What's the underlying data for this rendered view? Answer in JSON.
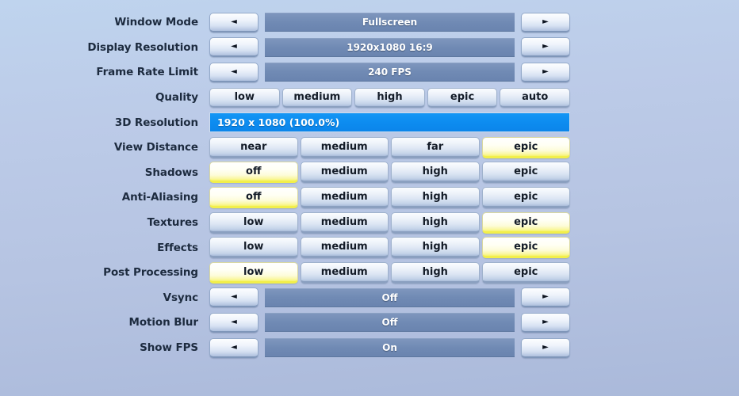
{
  "screen": {
    "name": "video-settings",
    "background_top": "#bfd4ee",
    "background_bottom": "#aab9da"
  },
  "icons": {
    "left_arrow": "◄",
    "right_arrow": "►"
  },
  "colors": {
    "selected_highlight": "#f6f36c",
    "slider_fill": "#0d8cf0",
    "value_bar": "#708ab4",
    "label_text": "#1d2b3f"
  },
  "rows": [
    {
      "label": "Window Mode",
      "type": "spinner",
      "value": "Fullscreen"
    },
    {
      "label": "Display Resolution",
      "type": "spinner",
      "value": "1920x1080 16:9"
    },
    {
      "label": "Frame Rate Limit",
      "type": "spinner",
      "value": "240 FPS"
    },
    {
      "label": "Quality",
      "type": "segmented",
      "options": [
        "low",
        "medium",
        "high",
        "epic",
        "auto"
      ],
      "selected": null
    },
    {
      "label": "3D Resolution",
      "type": "slider",
      "value": "1920 x 1080 (100.0%)",
      "percent": 100
    },
    {
      "label": "View Distance",
      "type": "segmented",
      "options": [
        "near",
        "medium",
        "far",
        "epic"
      ],
      "selected": 3
    },
    {
      "label": "Shadows",
      "type": "segmented",
      "options": [
        "off",
        "medium",
        "high",
        "epic"
      ],
      "selected": 0
    },
    {
      "label": "Anti-Aliasing",
      "type": "segmented",
      "options": [
        "off",
        "medium",
        "high",
        "epic"
      ],
      "selected": 0
    },
    {
      "label": "Textures",
      "type": "segmented",
      "options": [
        "low",
        "medium",
        "high",
        "epic"
      ],
      "selected": 3
    },
    {
      "label": "Effects",
      "type": "segmented",
      "options": [
        "low",
        "medium",
        "high",
        "epic"
      ],
      "selected": 3
    },
    {
      "label": "Post Processing",
      "type": "segmented",
      "options": [
        "low",
        "medium",
        "high",
        "epic"
      ],
      "selected": 0
    },
    {
      "label": "Vsync",
      "type": "spinner",
      "value": "Off"
    },
    {
      "label": "Motion Blur",
      "type": "spinner",
      "value": "Off"
    },
    {
      "label": "Show FPS",
      "type": "spinner",
      "value": "On"
    }
  ]
}
